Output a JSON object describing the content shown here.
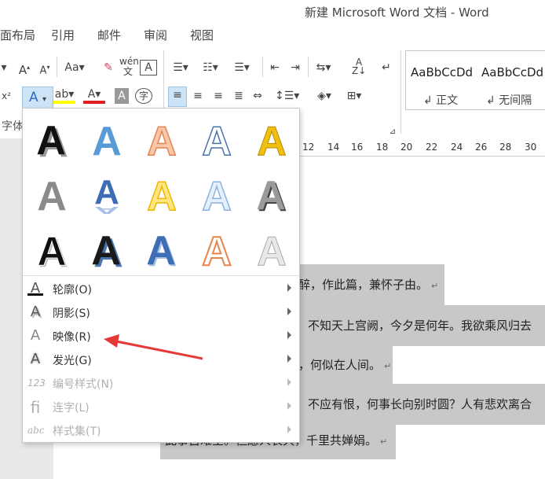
{
  "window": {
    "title": "新建 Microsoft Word 文档 - Word"
  },
  "tabs": [
    {
      "label": "面布局"
    },
    {
      "label": "引用"
    },
    {
      "label": "邮件"
    },
    {
      "label": "审阅"
    },
    {
      "label": "视图"
    }
  ],
  "ribbon": {
    "group_font_label": "字体",
    "styles": [
      {
        "example": "AaBbCcDd",
        "name": "↲ 正文"
      },
      {
        "example": "AaBbCcDd",
        "name": "↲ 无间隔"
      }
    ],
    "colors": {
      "text_highlight": "#ffff00",
      "font_color": "#e02020",
      "accent_blue": "#2b579a"
    }
  },
  "ruler": {
    "ticks": [
      "12",
      "14",
      "16",
      "18",
      "20",
      "22",
      "24",
      "26",
      "28",
      "30"
    ]
  },
  "document": {
    "lines": [
      "醉，作此篇，兼怀子由。",
      "不知天上宫阙，今夕是何年。我欲乘风归去",
      "，何似在人间。",
      "不应有恨，何事长向别时圆？人有悲欢离合",
      "此事古难全。但愿人长久，千里共婵娟。"
    ],
    "paragraph_mark": "↵"
  },
  "text_effects_menu": {
    "gallery_icons": [
      "black-shadow-a-icon",
      "blue-gradient-a-icon",
      "orange-outline-a-icon",
      "blue-outline-a-icon",
      "gold-a-icon",
      "gray-a-icon",
      "blue-reflect-a-icon",
      "yellow-outline-a-icon",
      "lightblue-outline-a-icon",
      "gray-bevel-a-icon",
      "black-bold-a-icon",
      "black-blue-a-icon",
      "blue-bold-a-icon",
      "orange-white-a-icon",
      "silver-a-icon"
    ],
    "items": [
      {
        "label": "轮廓(O)",
        "icon": "outline-a-icon",
        "enabled": true
      },
      {
        "label": "阴影(S)",
        "icon": "shadow-a-icon",
        "enabled": true
      },
      {
        "label": "映像(R)",
        "icon": "reflection-a-icon",
        "enabled": true
      },
      {
        "label": "发光(G)",
        "icon": "glow-a-icon",
        "enabled": true
      },
      {
        "label": "编号样式(N)",
        "icon": "number-style-icon",
        "enabled": false
      },
      {
        "label": "连字(L)",
        "icon": "ligature-icon",
        "enabled": false
      },
      {
        "label": "样式集(T)",
        "icon": "style-set-icon",
        "enabled": false
      }
    ]
  },
  "annotation": {
    "color": "#e53935"
  }
}
